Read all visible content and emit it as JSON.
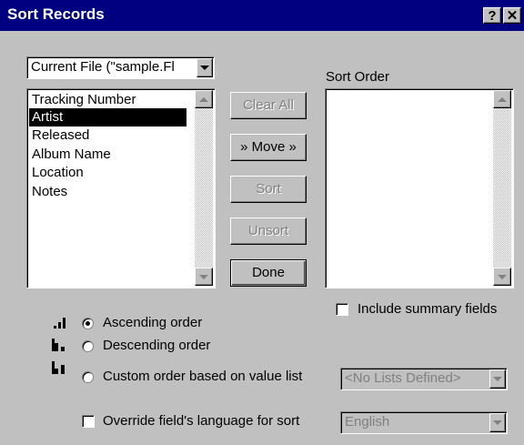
{
  "window": {
    "title": "Sort Records",
    "help_glyph": "?",
    "close_glyph": "✕"
  },
  "source_select": {
    "value": "Current File (\"sample.Fl"
  },
  "fields_list": {
    "items": [
      "Tracking Number",
      "Artist",
      "Released",
      "Album Name",
      "Location",
      "Notes"
    ],
    "selected": "Artist"
  },
  "buttons": {
    "clear_all": "Clear All",
    "move": "» Move »",
    "sort": "Sort",
    "unsort": "Unsort",
    "done": "Done"
  },
  "sort_order": {
    "label": "Sort Order"
  },
  "include_summary": {
    "label": "Include summary fields",
    "checked": false
  },
  "order": {
    "ascending": "Ascending order",
    "descending": "Descending order",
    "custom": "Custom order based on value list",
    "selected": "ascending",
    "value_list_select": "<No Lists Defined>"
  },
  "override_language": {
    "label": "Override field's language for sort",
    "checked": false,
    "language_select": "English"
  },
  "icons": [
    "ascending-bars-icon",
    "descending-bars-icon",
    "custom-bars-icon",
    "help-icon",
    "close-icon"
  ]
}
